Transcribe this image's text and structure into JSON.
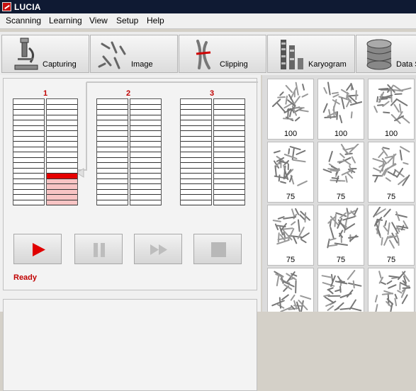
{
  "window": {
    "title": "LUCIA"
  },
  "menu": [
    "Scanning",
    "Learning",
    "View",
    "Setup",
    "Help"
  ],
  "toolbar": [
    {
      "label": "Capturing",
      "icon": "microscope-icon"
    },
    {
      "label": "Image",
      "icon": "chromosomes-icon"
    },
    {
      "label": "Clipping",
      "icon": "chromosome-clip-icon"
    },
    {
      "label": "Karyogram",
      "icon": "karyogram-icon"
    },
    {
      "label": "Data S",
      "icon": "database-icon"
    }
  ],
  "magazines": [
    {
      "label": "1",
      "slots": 20,
      "active_slot": 14,
      "filled_from": 15
    },
    {
      "label": "2",
      "slots": 20
    },
    {
      "label": "3",
      "slots": 20
    }
  ],
  "controls": [
    {
      "name": "play",
      "icon": "play-icon",
      "enabled": true
    },
    {
      "name": "pause",
      "icon": "pause-icon",
      "enabled": false
    },
    {
      "name": "forward",
      "icon": "fast-forward-icon",
      "enabled": false
    },
    {
      "name": "stop",
      "icon": "stop-icon",
      "enabled": false
    }
  ],
  "status": "Ready",
  "thumbnails": {
    "rows": [
      [
        "100",
        "100",
        "100"
      ],
      [
        "75",
        "75",
        "75"
      ],
      [
        "75",
        "75",
        "75"
      ],
      [
        "",
        "",
        ""
      ]
    ]
  },
  "colors": {
    "accent": "#c00000",
    "active_slot": "#e60000",
    "filled_slot": "#f8c4c4",
    "titlebar": "#0f1a33"
  }
}
